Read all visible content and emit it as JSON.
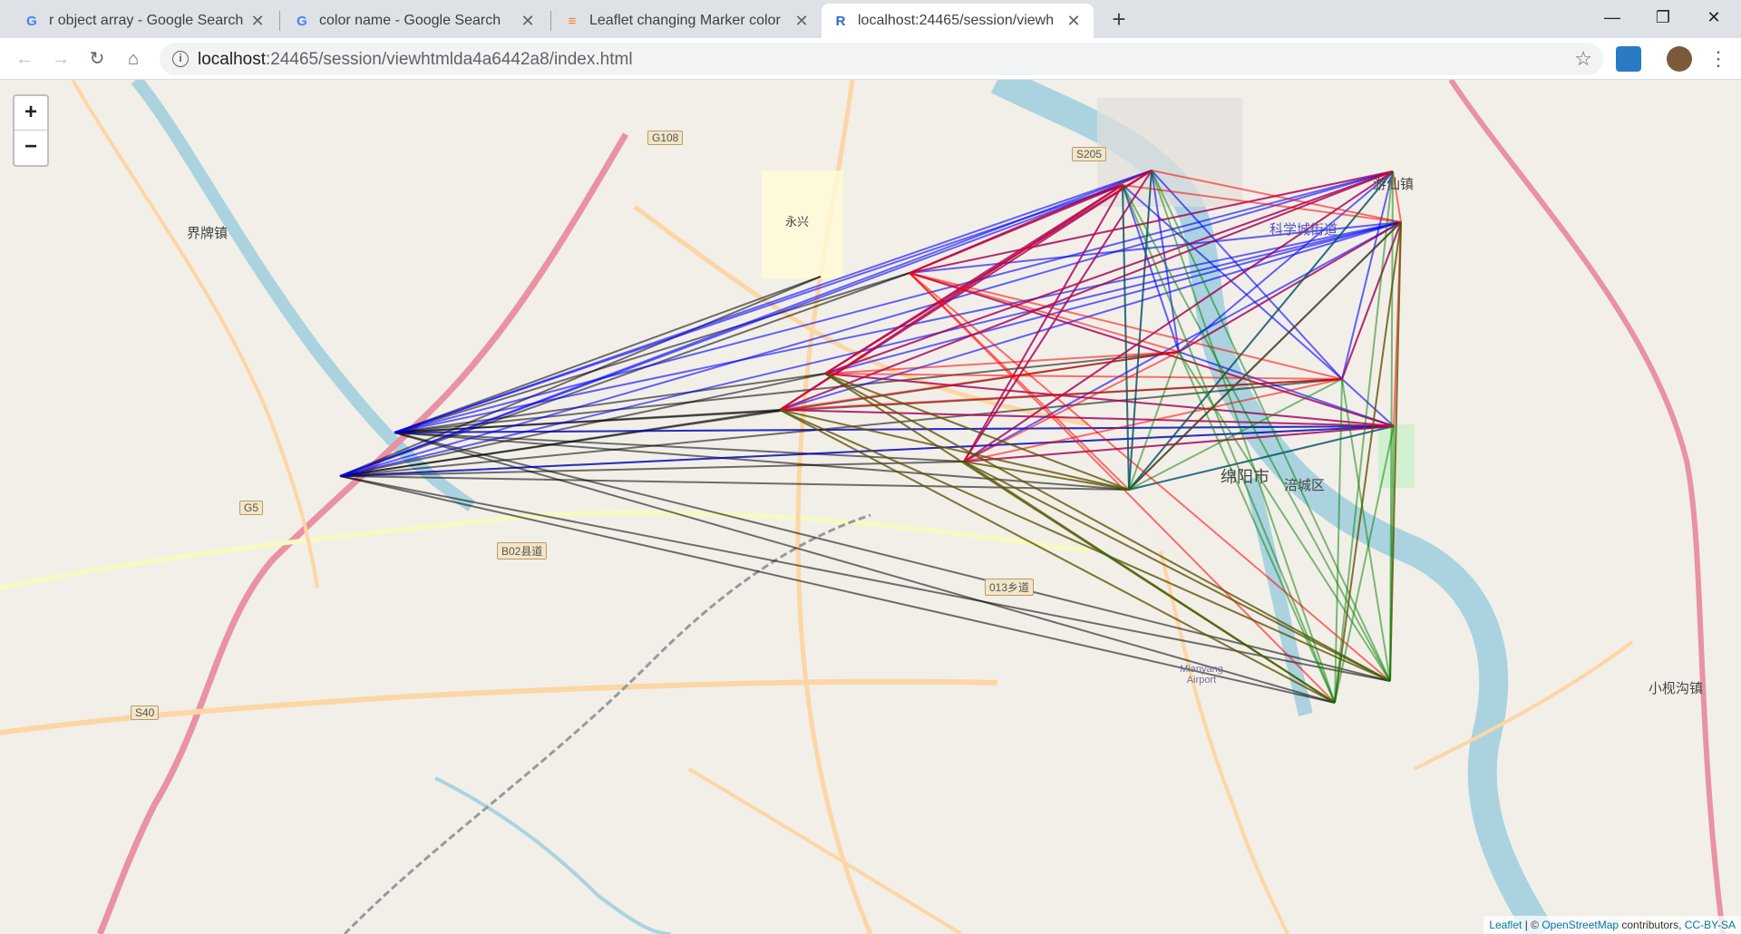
{
  "browser": {
    "tabs": [
      {
        "title": "r object array - Google Search",
        "favicon": "google-icon"
      },
      {
        "title": "color name - Google Search",
        "favicon": "google-icon"
      },
      {
        "title": "Leaflet changing Marker color",
        "favicon": "stackoverflow-icon"
      },
      {
        "title": "localhost:24465/session/viewh",
        "favicon": "r-icon"
      }
    ],
    "address": {
      "host": "localhost",
      "path": ":24465/session/viewhtmlda4a6442a8/index.html"
    },
    "window_controls": {
      "minimize": "—",
      "restore": "❐",
      "close": "✕"
    },
    "new_tab": "+"
  },
  "map": {
    "zoom_in": "+",
    "zoom_out": "−",
    "attribution": {
      "leaflet": "Leaflet",
      "sep": " | © ",
      "osm": "OpenStreetMap",
      "contributors": " contributors, ",
      "license": "CC-BY-SA"
    },
    "place_labels": [
      {
        "name": "界牌镇"
      },
      {
        "name": "永兴"
      },
      {
        "name": "游仙镇"
      },
      {
        "name": "科学城街道"
      },
      {
        "name": "小枧沟镇"
      },
      {
        "name": "Mianyang Airport"
      },
      {
        "name": "绵阳市"
      },
      {
        "name": "涪城区"
      }
    ],
    "road_shields": [
      "G108",
      "S205",
      "G5",
      "S40",
      "B02县道",
      "013乡道"
    ],
    "line_colors": {
      "blue": "#0000ff",
      "red": "#ff0000",
      "green": "#008000",
      "black": "#000000"
    }
  }
}
